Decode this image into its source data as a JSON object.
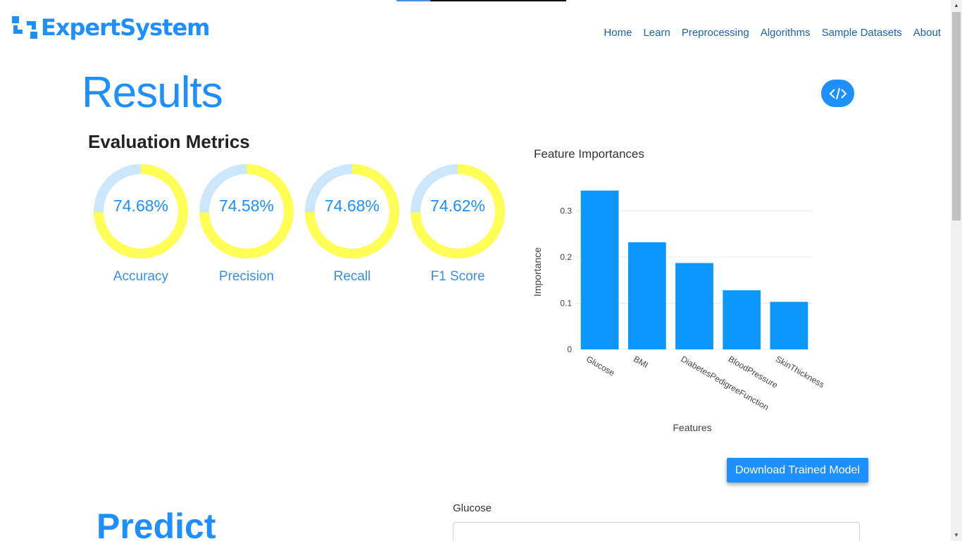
{
  "brand": {
    "name": "ExpertSystem",
    "color": "#1e8fff"
  },
  "nav": [
    "Home",
    "Learn",
    "Preprocessing",
    "Algorithms",
    "Sample Datasets",
    "About"
  ],
  "results": {
    "title": "Results",
    "code_icon": "code-icon"
  },
  "evaluation": {
    "title": "Evaluation Metrics",
    "metrics": [
      {
        "label": "Accuracy",
        "value": "74.68%",
        "fraction": 0.7468
      },
      {
        "label": "Precision",
        "value": "74.58%",
        "fraction": 0.7458
      },
      {
        "label": "Recall",
        "value": "74.68%",
        "fraction": 0.7468
      },
      {
        "label": "F1 Score",
        "value": "74.62%",
        "fraction": 0.7462
      }
    ],
    "ring_color": "#ffff55",
    "ring_track_color": "#cce6fb"
  },
  "chart_data": {
    "type": "bar",
    "title": "Feature Importances",
    "xlabel": "Features",
    "ylabel": "Importance",
    "categories": [
      "Glucose",
      "BMI",
      "DiabetesPedigreeFunction",
      "BloodPressure",
      "SkinThickness"
    ],
    "values": [
      0.344,
      0.232,
      0.187,
      0.128,
      0.103
    ],
    "yticks": [
      "0",
      "0.1",
      "0.2",
      "0.3"
    ],
    "ylim": [
      0,
      0.36
    ],
    "grid": true,
    "bar_color": "#0a96fa"
  },
  "download_button": "Download Trained Model",
  "predict": {
    "title": "Predict",
    "field_label": "Glucose",
    "field_value": ""
  }
}
